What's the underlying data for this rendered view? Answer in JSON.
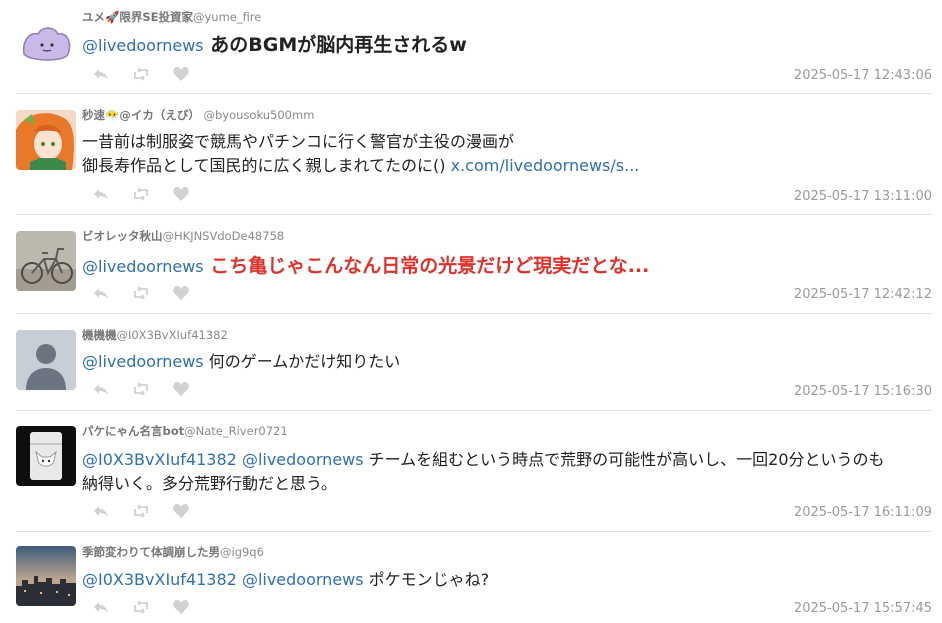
{
  "colors": {
    "mention": "#2f6fb7",
    "highlight_red": "#e0322b",
    "meta": "#9a9a9a"
  },
  "tweets": [
    {
      "display_name": "ユメ🚀限界SE投資家",
      "handle": "@yume_fire",
      "avatar": "ditto-avatar",
      "mention1": "@livedoornews",
      "text": " あのBGMが脳内再生されるw",
      "timestamp": "2025-05-17 12:43:06"
    },
    {
      "display_name": "秒速😶‍🌫️@イカ（えび）",
      "handle": "@byousoku500mm",
      "avatar": "anime-girl-avatar",
      "text_line1": "一昔前は制服姿で競馬やパチンコに行く警官が主役の漫画が",
      "text_line2": "御長寿作品として国民的に広く親しまれてたのに() ",
      "link": "x.com/livedoornews/s...",
      "timestamp": "2025-05-17 13:11:00"
    },
    {
      "display_name": "ビオレッタ秋山",
      "handle": "@HKJNSVdoDe48758",
      "avatar": "bicycle-avatar",
      "mention1": "@livedoornews",
      "text": " こち亀じゃこんなん日常の光景だけど現実だとな...",
      "timestamp": "2025-05-17 12:42:12"
    },
    {
      "display_name": "機機機",
      "handle": "@I0X3BvXIuf41382",
      "avatar": "default-user-avatar",
      "mention1": "@livedoornews",
      "text": " 何のゲームかだけ知りたい",
      "timestamp": "2025-05-17 15:16:30"
    },
    {
      "display_name": "パケにゃん名言bot",
      "handle": "@Nate_River0721",
      "avatar": "cat-bag-avatar",
      "mention1": "@I0X3BvXIuf41382",
      "mention2": "@livedoornews",
      "text_line1": " チームを組むという時点で荒野の可能性が高いし、一回20分というのも",
      "text_line2": "納得いく。多分荒野行動だと思う。",
      "timestamp": "2025-05-17 16:11:09"
    },
    {
      "display_name": "季節変わりて体調崩した男",
      "handle": "@ig9q6",
      "avatar": "cityscape-avatar",
      "mention1": "@I0X3BvXIuf41382",
      "mention2": "@livedoornews",
      "text": " ポケモンじゃね?",
      "timestamp": "2025-05-17 15:57:45"
    }
  ]
}
